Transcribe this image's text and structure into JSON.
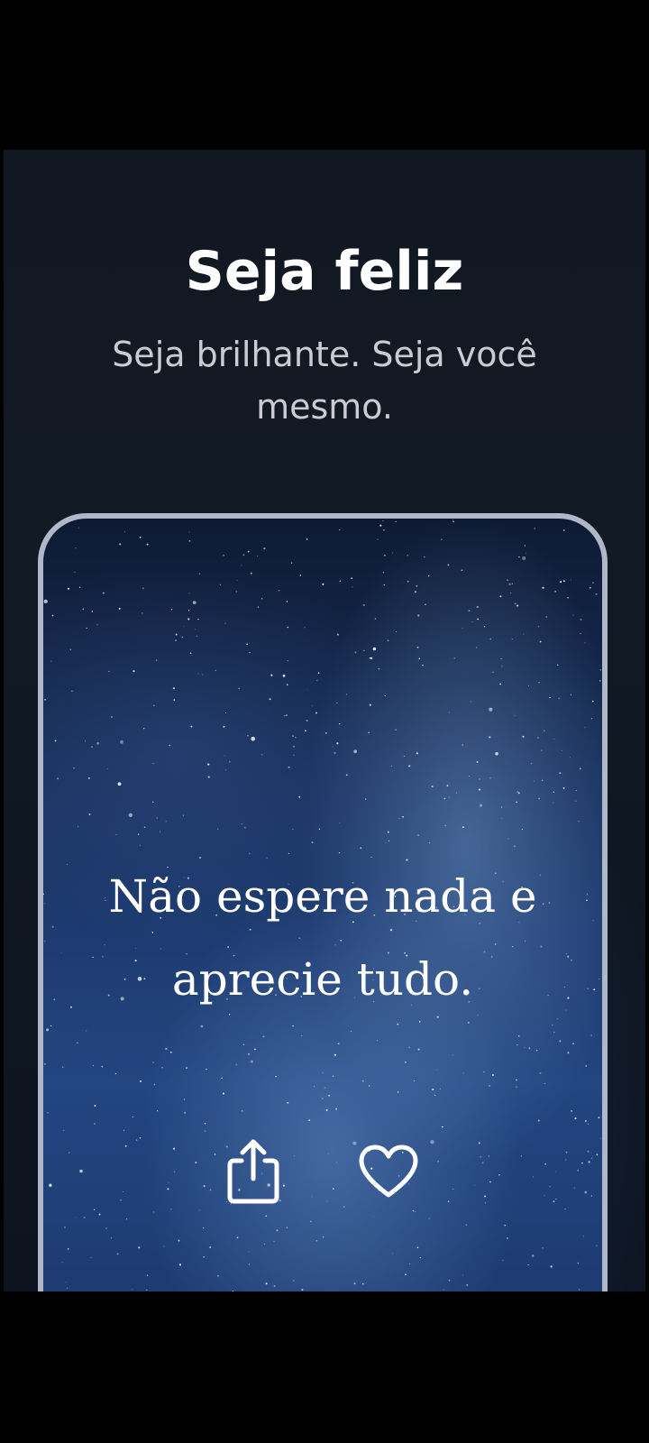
{
  "header": {
    "title": "Seja feliz",
    "subtitle": "Seja brilhante. Seja você mesmo."
  },
  "card": {
    "quote": "Não espere nada e aprecie tudo.",
    "actions": {
      "share_icon": "share-icon",
      "like_icon": "heart-icon"
    }
  },
  "colors": {
    "background": "#111821",
    "title": "#ffffff",
    "subtitle": "#c9cdd3",
    "frame_border": "#aeb8c8",
    "sky_accent": "#234580"
  }
}
